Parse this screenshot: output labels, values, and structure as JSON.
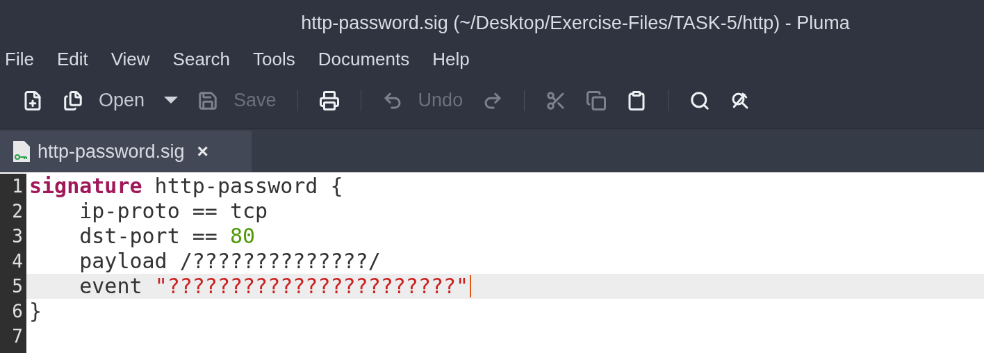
{
  "window": {
    "title": "http-password.sig (~/Desktop/Exercise-Files/TASK-5/http) - Pluma"
  },
  "menu": [
    "File",
    "Edit",
    "View",
    "Search",
    "Tools",
    "Documents",
    "Help"
  ],
  "toolbar": [
    {
      "kind": "button",
      "disabled": false
    },
    {
      "kind": "button",
      "label": "Open",
      "disabled": false
    },
    {
      "kind": "dropdown",
      "disabled": false
    },
    {
      "kind": "button",
      "label": "Save",
      "disabled": true
    },
    {
      "kind": "separator"
    },
    {
      "kind": "button",
      "disabled": false
    },
    {
      "kind": "separator"
    },
    {
      "kind": "button",
      "label": "Undo",
      "disabled": true
    },
    {
      "kind": "button",
      "disabled": true
    },
    {
      "kind": "separator"
    },
    {
      "kind": "button",
      "disabled": true
    },
    {
      "kind": "button",
      "disabled": true
    },
    {
      "kind": "button",
      "disabled": false
    },
    {
      "kind": "separator"
    },
    {
      "kind": "button",
      "disabled": false
    },
    {
      "kind": "button",
      "disabled": false
    }
  ],
  "tabs": [
    {
      "label": "http-password.sig",
      "close": "×",
      "selected": true
    }
  ],
  "editor": {
    "lines": [
      {
        "number": "1",
        "current": false,
        "tokens": [
          {
            "kind": "keyword",
            "text": "signature"
          },
          {
            "kind": "plain",
            "text": " http-password {"
          }
        ]
      },
      {
        "number": "2",
        "current": false,
        "tokens": [
          {
            "kind": "plain",
            "text": "    ip-proto == tcp"
          }
        ]
      },
      {
        "number": "3",
        "current": false,
        "tokens": [
          {
            "kind": "plain",
            "text": "    dst-port == "
          },
          {
            "kind": "number",
            "text": "80"
          }
        ]
      },
      {
        "number": "4",
        "current": false,
        "tokens": [
          {
            "kind": "plain",
            "text": "    payload /??????????????/"
          }
        ]
      },
      {
        "number": "5",
        "current": true,
        "tokens": [
          {
            "kind": "plain",
            "text": "    event "
          },
          {
            "kind": "string",
            "text": "\"???????????????????????\""
          }
        ]
      },
      {
        "number": "6",
        "current": false,
        "tokens": [
          {
            "kind": "plain",
            "text": "}"
          }
        ]
      },
      {
        "number": "7",
        "current": false
      }
    ]
  }
}
